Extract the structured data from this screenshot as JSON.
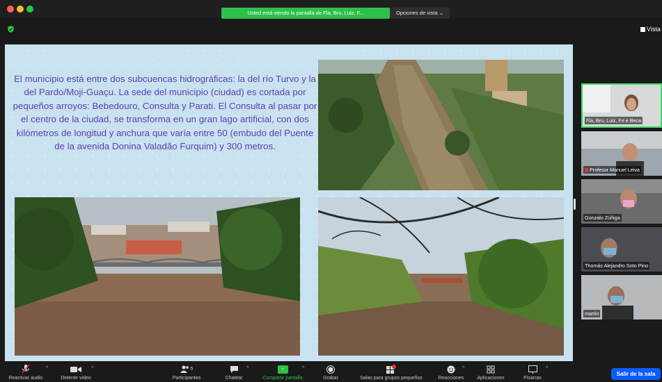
{
  "window": {
    "share_banner": "Usted está viendo la pantalla de Fla, Bru, Luiz, F...",
    "view_options": "Opciones de vista ⌄",
    "view_label": "Vista"
  },
  "slide": {
    "text": "El municipio está entre dos subcuencas hidrográficas: la del río Turvo y la del Pardo/Moji-Guaçu. La sede del municipio (ciudad) es cortada por pequeños arroyos: Bebedouro, Consulta y Parati. El Consulta al pasar por el centro de la ciudad, se transforma en un gran lago artificial, con dos kilómetros de longitud y anchura que varía entre 50 (embudo del Puente de la avenida Donina Valadão Furquim) y 300 metros."
  },
  "participants_panel": {
    "tiles": [
      {
        "name": "Fla, Bru, Luiz, Fe e Beca",
        "muted": false
      },
      {
        "name": "Profesor Manuel Leiva",
        "muted": true
      },
      {
        "name": "Gonzalo Zúñiga",
        "muted": false
      },
      {
        "name": "Thomás Alejandro Soto Pino",
        "muted": false
      },
      {
        "name": "martín",
        "muted": false
      }
    ]
  },
  "toolbar": {
    "unmute": "Reactivar audio",
    "stop_video": "Detener video",
    "participants": "Participantes",
    "participants_count": "5",
    "chat": "Chatear",
    "share_screen": "Compartir pantalla",
    "record": "Grabar",
    "breakout": "Salas para grupos pequeños",
    "reactions": "Reacciones",
    "apps": "Aplicaciones",
    "whiteboards": "Pizarras",
    "leave": "Salir de la sala"
  },
  "colors": {
    "accent_green": "#2fc04b",
    "leave_blue": "#0b5cff",
    "slide_text": "#5b3fb3",
    "slide_background": "#c9e2ef"
  }
}
